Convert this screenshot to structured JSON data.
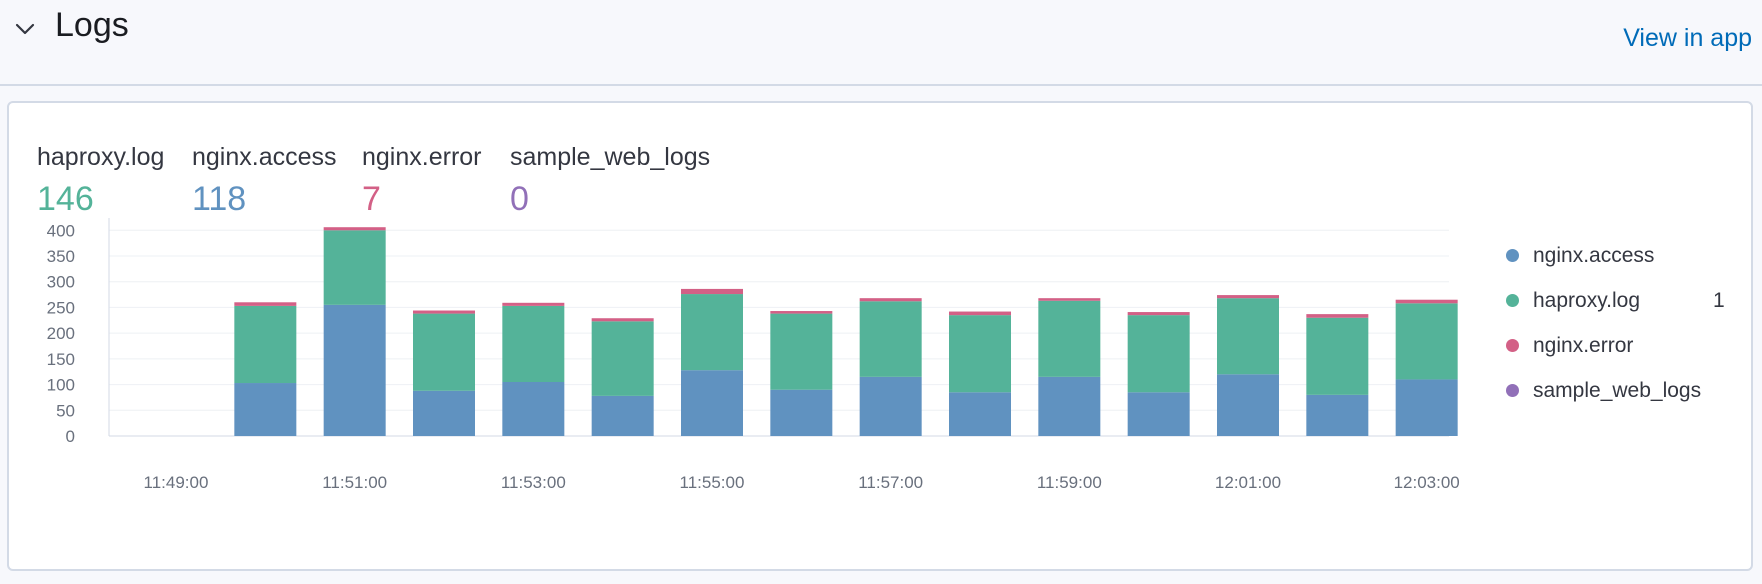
{
  "section": {
    "title": "Logs",
    "view_link": "View in app"
  },
  "stats": [
    {
      "label": "haproxy.log",
      "value": "146",
      "color": "#54b399"
    },
    {
      "label": "nginx.access",
      "value": "118",
      "color": "#6092c0"
    },
    {
      "label": "nginx.error",
      "value": "7",
      "color": "#d36086"
    },
    {
      "label": "sample_web_logs",
      "value": "0",
      "color": "#9170b8"
    }
  ],
  "legend": [
    {
      "label": "nginx.access",
      "color": "#6092c0",
      "extra": ""
    },
    {
      "label": "haproxy.log",
      "color": "#54b399",
      "extra": "1"
    },
    {
      "label": "nginx.error",
      "color": "#d36086",
      "extra": ""
    },
    {
      "label": "sample_web_logs",
      "color": "#9170b8",
      "extra": ""
    }
  ],
  "chart_data": {
    "type": "bar",
    "stacked": true,
    "x": [
      "11:48:30",
      "11:49:00",
      "11:49:30",
      "11:50:00",
      "11:50:30",
      "11:51:00",
      "11:51:30",
      "11:52:00",
      "11:52:30",
      "11:53:00",
      "11:53:30",
      "11:54:00",
      "11:54:30",
      "11:55:00",
      "11:55:30",
      "11:56:00",
      "11:56:30",
      "11:57:00",
      "11:57:30",
      "11:58:00",
      "11:58:30",
      "11:59:00",
      "11:59:30",
      "12:00:00",
      "12:00:30",
      "12:01:00",
      "12:01:30",
      "12:02:00",
      "12:02:30",
      "12:03:00"
    ],
    "xticks": [
      "11:49:00",
      "11:51:00",
      "11:53:00",
      "11:55:00",
      "11:57:00",
      "11:59:00",
      "12:01:00",
      "12:03:00"
    ],
    "yticks": [
      0,
      50,
      100,
      150,
      200,
      250,
      300,
      350,
      400
    ],
    "ylim": [
      0,
      420
    ],
    "grid": true,
    "series": [
      {
        "name": "nginx.access",
        "color": "#6092c0",
        "values": [
          null,
          null,
          null,
          103,
          null,
          255,
          null,
          88,
          null,
          105,
          null,
          78,
          null,
          128,
          null,
          90,
          null,
          115,
          null,
          85,
          null,
          115,
          null,
          85,
          null,
          120,
          null,
          80,
          null,
          110
        ]
      },
      {
        "name": "haproxy.log",
        "color": "#54b399",
        "values": [
          null,
          null,
          null,
          150,
          null,
          145,
          null,
          150,
          null,
          148,
          null,
          145,
          null,
          148,
          null,
          148,
          null,
          147,
          null,
          150,
          null,
          148,
          null,
          150,
          null,
          148,
          null,
          150,
          null,
          148
        ]
      },
      {
        "name": "nginx.error",
        "color": "#d36086",
        "values": [
          null,
          null,
          null,
          7,
          null,
          6,
          null,
          6,
          null,
          6,
          null,
          6,
          null,
          10,
          null,
          5,
          null,
          6,
          null,
          7,
          null,
          5,
          null,
          6,
          null,
          6,
          null,
          7,
          null,
          7
        ]
      },
      {
        "name": "sample_web_logs",
        "color": "#9170b8",
        "values": [
          null,
          null,
          null,
          0,
          null,
          0,
          null,
          0,
          null,
          0,
          null,
          0,
          null,
          0,
          null,
          0,
          null,
          0,
          null,
          0,
          null,
          0,
          null,
          0,
          null,
          0,
          null,
          0,
          null,
          0
        ]
      }
    ]
  }
}
